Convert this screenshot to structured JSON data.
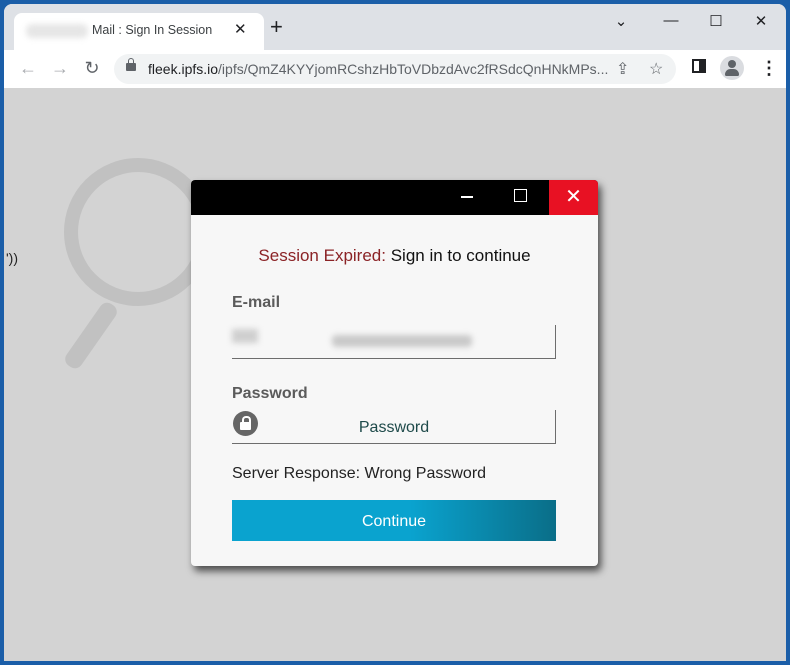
{
  "browser": {
    "tab": {
      "title": "Mail : Sign In Session",
      "close_glyph": "✕"
    },
    "new_tab_glyph": "+",
    "window_controls": {
      "tablist": "⌄",
      "minimize": "—",
      "maximize": "☐",
      "close": "✕"
    },
    "nav": {
      "back": "←",
      "forward": "→",
      "reload": "↻"
    },
    "url": {
      "host": "fleek.ipfs.io",
      "path": "/ipfs/QmZ4KYYjomRCshzHbToVDbzdAvc2fRSdcQnHNkMPs..."
    },
    "omnibox_icons": {
      "share": "⇪",
      "bookmark": "☆"
    },
    "menu_glyph": "⋮"
  },
  "page": {
    "stray_text": "'))"
  },
  "dialog": {
    "close_glyph": "✕",
    "heading_prefix": "Session Expired:",
    "heading_suffix": " Sign in to continue",
    "email_label": "E-mail",
    "password_label": "Password",
    "password_placeholder": "Password",
    "server_response": "Server Response: Wrong Password",
    "continue_label": "Continue"
  }
}
